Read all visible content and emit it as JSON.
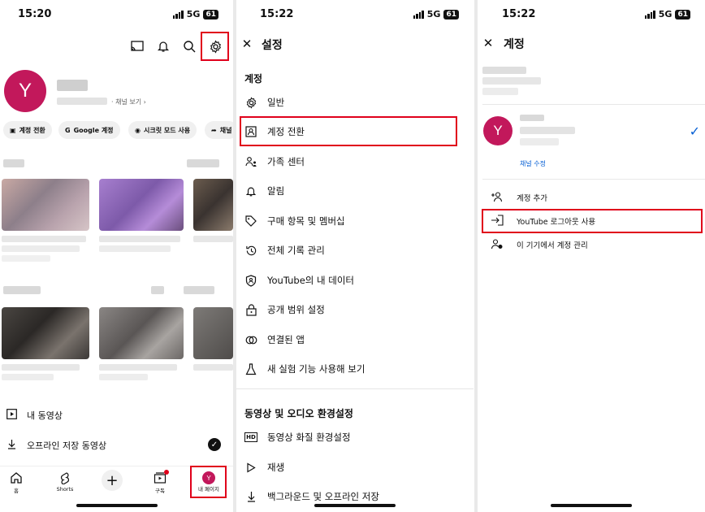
{
  "panel_home": {
    "status": {
      "time": "15:20",
      "network": "5G",
      "battery": "61"
    },
    "avatar_letter": "Y",
    "channel_link": "채널 보기",
    "chips": [
      "계정 전환",
      "Google 계정",
      "시크릿 모드 사용",
      "채널"
    ],
    "list": [
      {
        "label": "내 동영상"
      },
      {
        "label": "오프라인 저장 동영상"
      }
    ],
    "nav": [
      "홈",
      "Shorts",
      "",
      "구독",
      "내 페이지"
    ]
  },
  "panel_settings": {
    "status": {
      "time": "15:22",
      "network": "5G",
      "battery": "61"
    },
    "title": "설정",
    "section_account": "계정",
    "items": [
      {
        "label": "일반",
        "icon": "gear-icon"
      },
      {
        "label": "계정 전환",
        "icon": "account-switch-icon"
      },
      {
        "label": "가족 센터",
        "icon": "family-icon"
      },
      {
        "label": "알림",
        "icon": "bell-icon"
      },
      {
        "label": "구매 항목 및 멤버십",
        "icon": "tag-icon"
      },
      {
        "label": "전체 기록 관리",
        "icon": "history-icon"
      },
      {
        "label": "YouTube의 내 데이터",
        "icon": "shield-icon"
      },
      {
        "label": "공개 범위 설정",
        "icon": "lock-icon"
      },
      {
        "label": "연결된 앱",
        "icon": "link-icon"
      },
      {
        "label": "새 실험 기능 사용해 보기",
        "icon": "flask-icon"
      }
    ],
    "section_video": "동영상 및 오디오 환경설정",
    "video_items": [
      {
        "label": "동영상 화질 환경설정",
        "icon": "hd-icon"
      },
      {
        "label": "재생",
        "icon": "play-icon"
      },
      {
        "label": "백그라운드 및 오프라인 저장",
        "icon": "download-icon"
      }
    ]
  },
  "panel_account": {
    "status": {
      "time": "15:22",
      "network": "5G",
      "battery": "61"
    },
    "title": "계정",
    "avatar_letter": "Y",
    "edit_channel": "채널 수정",
    "rows": [
      {
        "label": "계정 추가",
        "icon": "add-account-icon"
      },
      {
        "label": "YouTube 로그아웃 사용",
        "icon": "logout-icon"
      },
      {
        "label": "이 기기에서 계정 관리",
        "icon": "manage-accounts-icon"
      }
    ]
  },
  "colors": {
    "highlight": "#e0001b",
    "avatar": "#c2185b",
    "link": "#065fd4"
  }
}
